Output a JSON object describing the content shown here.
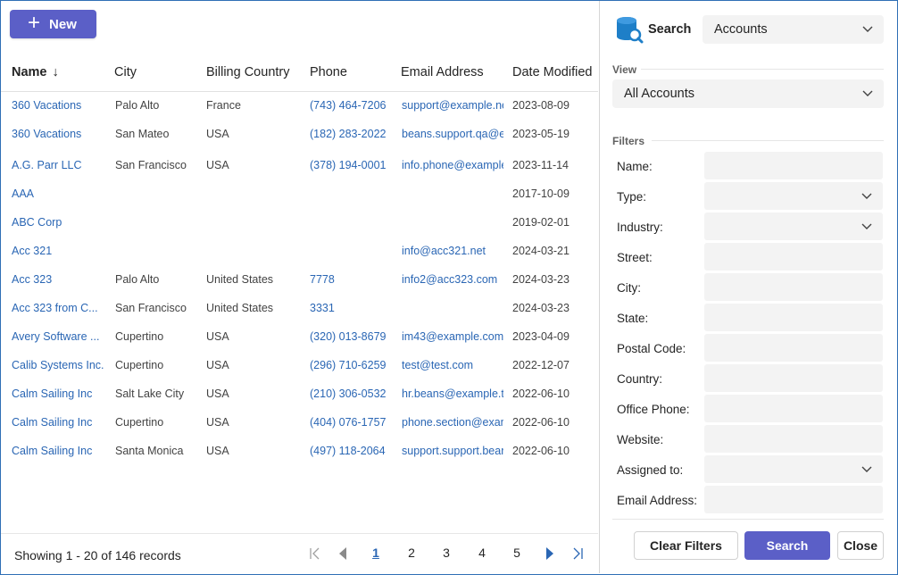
{
  "toolbar": {
    "new_label": "New"
  },
  "grid": {
    "columns": [
      "Name",
      "City",
      "Billing Country",
      "Phone",
      "Email Address",
      "Date Modified"
    ],
    "sort_arrow": "↓",
    "rows": [
      {
        "name": "360 Vacations",
        "city": "Palo Alto",
        "country": "France",
        "phone": "(743) 464-7206",
        "email": "support@example.ne",
        "date": "2023-08-09"
      },
      {
        "name": "360 Vacations",
        "city": "San Mateo",
        "country": "USA",
        "phone": "(182) 283-2022",
        "email": "beans.support.qa@e",
        "date": "2023-05-19"
      },
      {
        "name": "A.G. Parr LLC",
        "city": "San Francisco",
        "country": "USA",
        "phone": "(378) 194-0001",
        "email": "info.phone@example",
        "date": "2023-11-14"
      },
      {
        "name": "AAA",
        "city": "",
        "country": "",
        "phone": "",
        "email": "",
        "date": "2017-10-09"
      },
      {
        "name": "ABC Corp",
        "city": "",
        "country": "",
        "phone": "",
        "email": "",
        "date": "2019-02-01"
      },
      {
        "name": "Acc 321",
        "city": "",
        "country": "",
        "phone": "",
        "email": "info@acc321.net",
        "date": "2024-03-21"
      },
      {
        "name": "Acc 323",
        "city": "Palo Alto",
        "country": "United States",
        "phone": "7778",
        "email": "info2@acc323.com",
        "date": "2024-03-23"
      },
      {
        "name": "Acc 323 from C...",
        "city": "San Francisco",
        "country": "United States",
        "phone": "3331",
        "email": "",
        "date": "2024-03-23"
      },
      {
        "name": "Avery Software ...",
        "city": "Cupertino",
        "country": "USA",
        "phone": "(320) 013-8679",
        "email": "im43@example.com",
        "date": "2023-04-09"
      },
      {
        "name": "Calib Systems Inc.",
        "city": "Cupertino",
        "country": "USA",
        "phone": "(296) 710-6259",
        "email": "test@test.com",
        "date": "2022-12-07"
      },
      {
        "name": "Calm Sailing Inc",
        "city": "Salt Lake City",
        "country": "USA",
        "phone": "(210) 306-0532",
        "email": "hr.beans@example.tv",
        "date": "2022-06-10"
      },
      {
        "name": "Calm Sailing Inc",
        "city": "Cupertino",
        "country": "USA",
        "phone": "(404) 076-1757",
        "email": "phone.section@exam",
        "date": "2022-06-10"
      },
      {
        "name": "Calm Sailing Inc",
        "city": "Santa Monica",
        "country": "USA",
        "phone": "(497) 118-2064",
        "email": "support.support.bear",
        "date": "2022-06-10"
      }
    ]
  },
  "footer": {
    "showing": "Showing 1 - 20 of 146 records",
    "pages": [
      "1",
      "2",
      "3",
      "4",
      "5"
    ],
    "active_page": "1"
  },
  "panel": {
    "search_label": "Search",
    "module_select": "Accounts",
    "view_label": "View",
    "view_select": "All Accounts",
    "filters_label": "Filters",
    "filters": [
      {
        "label": "Name:",
        "type": "text"
      },
      {
        "label": "Type:",
        "type": "select"
      },
      {
        "label": "Industry:",
        "type": "select"
      },
      {
        "label": "Street:",
        "type": "text"
      },
      {
        "label": "City:",
        "type": "text"
      },
      {
        "label": "State:",
        "type": "text"
      },
      {
        "label": "Postal Code:",
        "type": "text"
      },
      {
        "label": "Country:",
        "type": "text"
      },
      {
        "label": "Office Phone:",
        "type": "text"
      },
      {
        "label": "Website:",
        "type": "text"
      },
      {
        "label": "Assigned to:",
        "type": "select"
      },
      {
        "label": "Email Address:",
        "type": "text"
      }
    ],
    "clear_label": "Clear Filters",
    "search_button": "Search",
    "close_button": "Close"
  },
  "colors": {
    "accent": "#5b5fc7",
    "link": "#2a66b4",
    "field_bg": "#f3f3f3",
    "db_icon": "#1e7fc8"
  }
}
